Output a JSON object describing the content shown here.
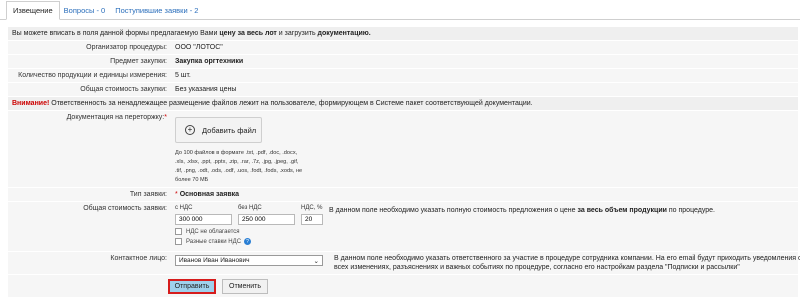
{
  "tabs": [
    {
      "label": "Извещение"
    },
    {
      "label": "Вопросы - 0"
    },
    {
      "label": "Поступившие заявки - 2"
    }
  ],
  "intro": {
    "p1": "Вы можете вписать в поля данной формы предлагаемую Вами ",
    "b1": "цену за весь лот",
    "p2": " и загрузить ",
    "b2": "документацию."
  },
  "info": [
    {
      "label": "Организатор процедуры:",
      "value": "ООО \"ЛОТОС\"",
      "bold": false
    },
    {
      "label": "Предмет закупки:",
      "value": "Закупка оргтехники",
      "bold": true
    },
    {
      "label": "Количество продукции и единицы измерения:",
      "value": "5 шт.",
      "bold": false
    },
    {
      "label": "Общая стоимость закупки:",
      "value": "Без указания цены",
      "bold": false
    }
  ],
  "warning": {
    "title": "Внимание!",
    "text": " Ответственность за ненадлежащее размещение файлов лежит на пользователе, формирующем в Системе пакет соответствующей документации."
  },
  "docs": {
    "label": "Документация на переторжку:",
    "upload_label": "Добавить файл",
    "hint": "До 100 файлов в формате .txt, .pdf, .doc, .docx, .xls, .xlsx, .ppt, .pptx, .zip, .rar, .7z, .jpg, .jpeg, .gif, .tif, .png, .odt, .ods, .odf, .uos, .fodt, .fods, .xods, не более 70 МБ"
  },
  "bid_type": {
    "label": "Тип заявки:",
    "value": "Основная заявка"
  },
  "cost": {
    "label": "Общая стоимость заявки:",
    "with_vat_label": "с НДС",
    "with_vat_value": "300 000",
    "no_vat_label": "без НДС",
    "no_vat_value": "250 000",
    "vat_label": "НДС, %",
    "vat_value": "20",
    "no_vat_check": "НДС не облагается",
    "diff_rates_check": "Разные ставки НДС",
    "desc1": "В данном поле необходимо указать полную стоимость предложения о цене ",
    "desc_bold": "за весь объем продукции",
    "desc2": " по процедуре."
  },
  "contact": {
    "label": "Контактное лицо:",
    "value": "Иванов Иван Иванович",
    "desc": "В данном поле необходимо указать ответственного за участие в процедуре сотрудника компании. На его email будут приходить уведомления о всех изменениях, разъяснениях и важных событиях по процедуре, согласно его настройкам раздела \"Подписки и рассылки\""
  },
  "buttons": {
    "submit": "Отправить",
    "cancel": "Отменить"
  }
}
